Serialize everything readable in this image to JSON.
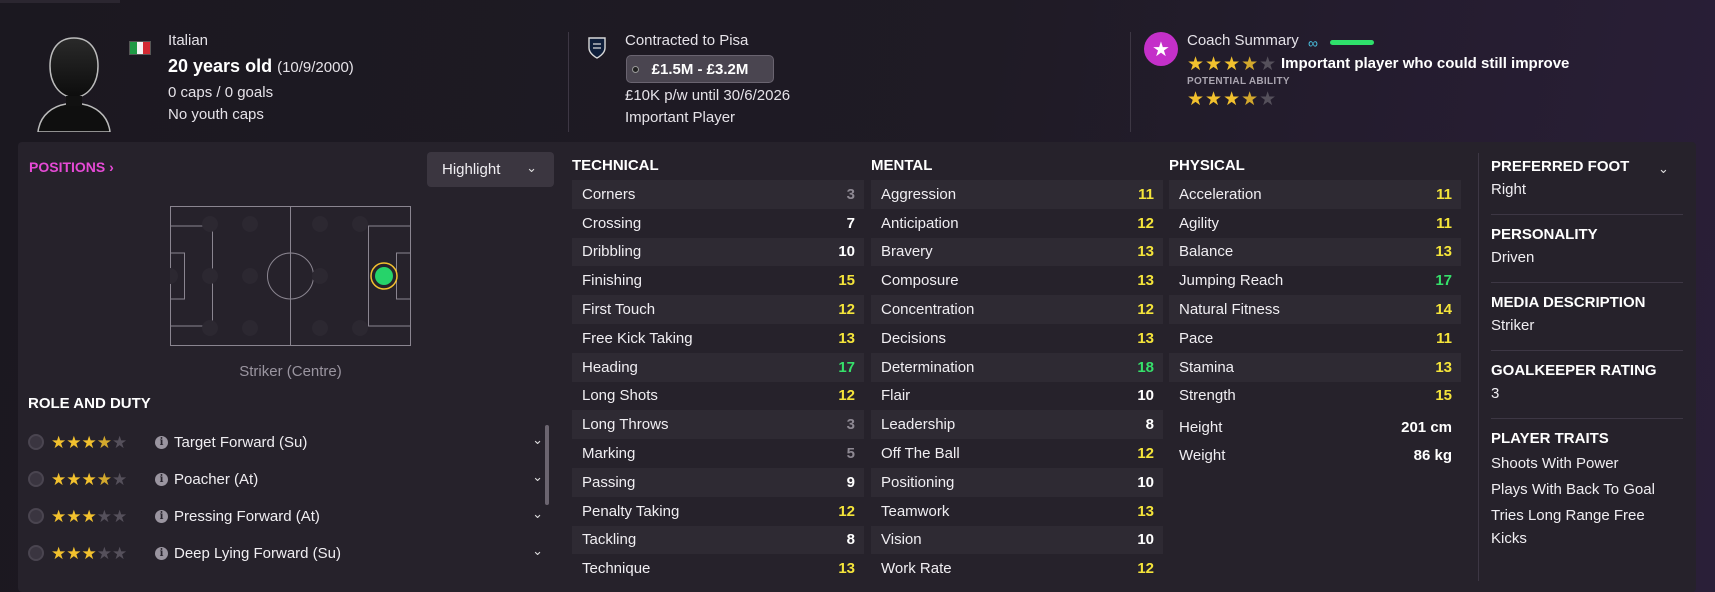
{
  "colors": {
    "accent_pink": "#e64ad6",
    "attr_low": "#8e8993",
    "attr_mid": "#ffffff",
    "attr_good": "#f4e43a",
    "attr_great": "#35e06a",
    "star": "#f2c12e"
  },
  "header": {
    "nationality": "Italian",
    "flag_icon": "italy-flag-icon",
    "age": "20 years old",
    "dob": "(10/9/2000)",
    "caps": "0 caps / 0 goals",
    "youth_caps": "No youth caps",
    "contract": "Contracted to Pisa",
    "value_range": "£1.5M - £3.2M",
    "wage": "£10K p/w until 30/6/2026",
    "squad_status": "Important Player",
    "coach_title": "Coach Summary",
    "coach_summary": "Important player who could still improve",
    "current_ability_stars": 3.5,
    "potential_label": "POTENTIAL ABILITY",
    "potential_ability_stars": 3.5
  },
  "positions": {
    "link": "POSITIONS",
    "highlight": "Highlight",
    "position_label": "Striker (Centre)"
  },
  "roles": {
    "title": "ROLE AND DUTY",
    "items": [
      {
        "name": "Target Forward (Su)",
        "stars": 3.5
      },
      {
        "name": "Poacher (At)",
        "stars": 3.5
      },
      {
        "name": "Pressing Forward (At)",
        "stars": 3
      },
      {
        "name": "Deep Lying Forward (Su)",
        "stars": 3
      }
    ]
  },
  "technical": {
    "title": "TECHNICAL",
    "items": [
      {
        "name": "Corners",
        "value": "3"
      },
      {
        "name": "Crossing",
        "value": "7"
      },
      {
        "name": "Dribbling",
        "value": "10"
      },
      {
        "name": "Finishing",
        "value": "15"
      },
      {
        "name": "First Touch",
        "value": "12"
      },
      {
        "name": "Free Kick Taking",
        "value": "13"
      },
      {
        "name": "Heading",
        "value": "17"
      },
      {
        "name": "Long Shots",
        "value": "12"
      },
      {
        "name": "Long Throws",
        "value": "3"
      },
      {
        "name": "Marking",
        "value": "5"
      },
      {
        "name": "Passing",
        "value": "9"
      },
      {
        "name": "Penalty Taking",
        "value": "12"
      },
      {
        "name": "Tackling",
        "value": "8"
      },
      {
        "name": "Technique",
        "value": "13"
      }
    ]
  },
  "mental": {
    "title": "MENTAL",
    "items": [
      {
        "name": "Aggression",
        "value": "11"
      },
      {
        "name": "Anticipation",
        "value": "12"
      },
      {
        "name": "Bravery",
        "value": "13"
      },
      {
        "name": "Composure",
        "value": "13"
      },
      {
        "name": "Concentration",
        "value": "12"
      },
      {
        "name": "Decisions",
        "value": "13"
      },
      {
        "name": "Determination",
        "value": "18"
      },
      {
        "name": "Flair",
        "value": "10"
      },
      {
        "name": "Leadership",
        "value": "8"
      },
      {
        "name": "Off The Ball",
        "value": "12"
      },
      {
        "name": "Positioning",
        "value": "10"
      },
      {
        "name": "Teamwork",
        "value": "13"
      },
      {
        "name": "Vision",
        "value": "10"
      },
      {
        "name": "Work Rate",
        "value": "12"
      }
    ]
  },
  "physical": {
    "title": "PHYSICAL",
    "items": [
      {
        "name": "Acceleration",
        "value": "11"
      },
      {
        "name": "Agility",
        "value": "11"
      },
      {
        "name": "Balance",
        "value": "13"
      },
      {
        "name": "Jumping Reach",
        "value": "17"
      },
      {
        "name": "Natural Fitness",
        "value": "14"
      },
      {
        "name": "Pace",
        "value": "11"
      },
      {
        "name": "Stamina",
        "value": "13"
      },
      {
        "name": "Strength",
        "value": "15"
      }
    ],
    "height_label": "Height",
    "height": "201 cm",
    "weight_label": "Weight",
    "weight": "86 kg"
  },
  "info": {
    "preferred_foot_label": "PREFERRED FOOT",
    "preferred_foot": "Right",
    "personality_label": "PERSONALITY",
    "personality": "Driven",
    "media_label": "MEDIA DESCRIPTION",
    "media": "Striker",
    "gk_label": "GOALKEEPER RATING",
    "gk": "3",
    "traits_label": "PLAYER TRAITS",
    "traits": [
      "Shoots With Power",
      "Plays With Back To Goal",
      "Tries Long Range Free Kicks"
    ]
  }
}
